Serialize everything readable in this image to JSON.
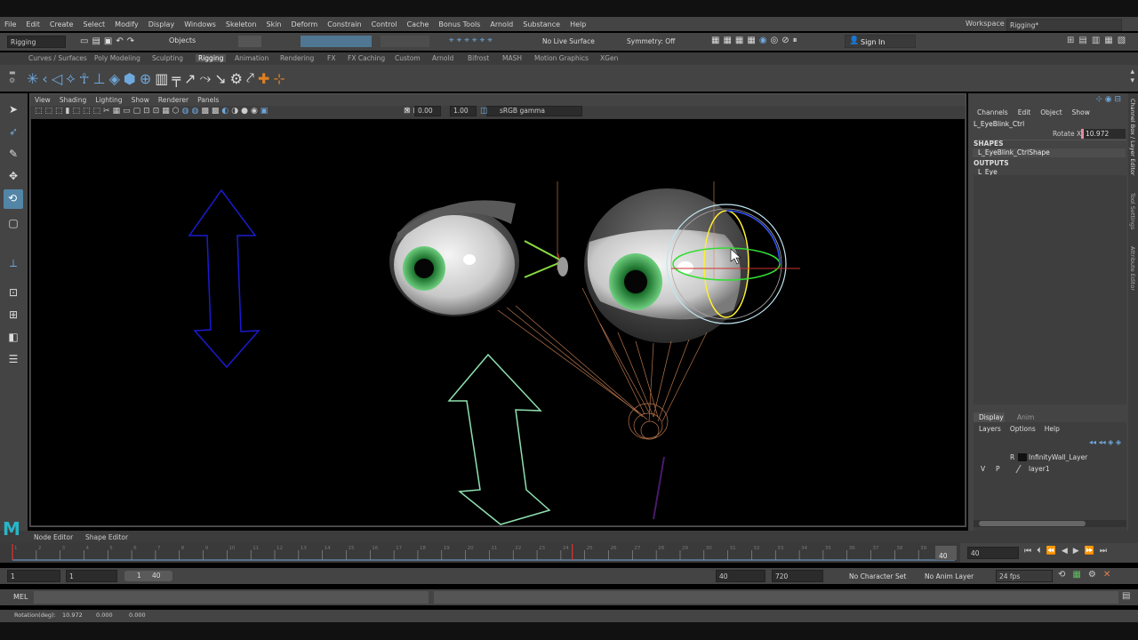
{
  "menubar": [
    "File",
    "Edit",
    "Create",
    "Select",
    "Modify",
    "Display",
    "Windows",
    "Skeleton",
    "Skin",
    "Deform",
    "Constrain",
    "Control",
    "Cache",
    "Bonus Tools",
    "Arnold",
    "Substance",
    "Help"
  ],
  "workspace": {
    "label": "Workspace :",
    "value": "Rigging*"
  },
  "status": {
    "menuset": "Rigging",
    "objects": "Objects",
    "live_surface": "No Live Surface",
    "symmetry": "Symmetry: Off",
    "sign_in": "Sign In"
  },
  "shelf_tabs": [
    "Curves / Surfaces",
    "Poly Modeling",
    "Sculpting",
    "Rigging",
    "Animation",
    "Rendering",
    "FX",
    "FX Caching",
    "Custom",
    "Arnold",
    "Bifrost",
    "MASH",
    "Motion Graphics",
    "XGen"
  ],
  "viewport": {
    "menus": [
      "View",
      "Shading",
      "Lighting",
      "Show",
      "Renderer",
      "Panels"
    ],
    "exposure": "0.00",
    "gamma": "1.00",
    "colorspace": "sRGB gamma"
  },
  "channel_box": {
    "menus": [
      "Channels",
      "Edit",
      "Object",
      "Show"
    ],
    "node": "L_EyeBlink_Ctrl",
    "attr_label": "Rotate X",
    "attr_value": "10.972",
    "shapes_header": "SHAPES",
    "shape": "L_EyeBlink_CtrlShape",
    "outputs_header": "OUTPUTS",
    "output": "L_Eye"
  },
  "side_tabs": [
    "Channel Box / Layer Editor",
    "Tool Settings",
    "Attribute Editor"
  ],
  "layer_editor": {
    "tabs": [
      "Display",
      "Anim"
    ],
    "menus": [
      "Layers",
      "Options",
      "Help"
    ],
    "layers": [
      {
        "v": "",
        "p": "",
        "r": "R",
        "name": "InfinityWall_Layer"
      },
      {
        "v": "V",
        "p": "P",
        "r": "",
        "name": "layer1"
      }
    ]
  },
  "bottom_tabs": [
    "Node Editor",
    "Shape Editor"
  ],
  "timeline": {
    "ticks": [
      "1",
      "2",
      "3",
      "4",
      "5",
      "6",
      "7",
      "8",
      "9",
      "10",
      "11",
      "12",
      "13",
      "14",
      "15",
      "16",
      "17",
      "18",
      "19",
      "20",
      "21",
      "22",
      "23",
      "24",
      "25",
      "26",
      "27",
      "28",
      "29",
      "30",
      "31",
      "32",
      "33",
      "34",
      "35",
      "36",
      "37",
      "38",
      "39",
      "40"
    ],
    "current_frame": "40",
    "end_field": "40"
  },
  "range": {
    "start": "1",
    "anim_start": "1",
    "slider_start": "1",
    "slider_end": "40",
    "anim_end": "40",
    "end": "720",
    "char_set": "No Character Set",
    "anim_layer": "No Anim Layer",
    "fps": "24 fps"
  },
  "command": {
    "lang": "MEL"
  },
  "helpline": {
    "label": "Rotation(deg):",
    "x": "10.972",
    "y": "0.000",
    "z": "0.000"
  },
  "colors": {
    "ui_bg": "#444444",
    "accent": "#5285a6",
    "viewport": "#000000",
    "playhead": "#e03030"
  },
  "icons": {
    "logo": "maya-logo-icon"
  }
}
